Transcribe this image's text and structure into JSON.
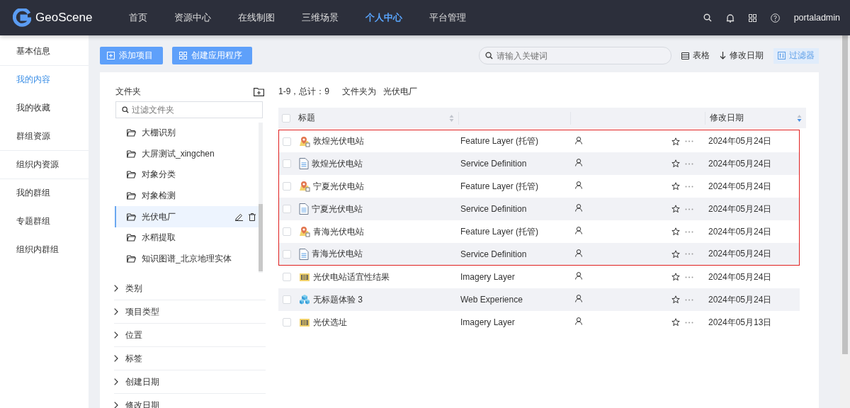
{
  "header": {
    "logo": "GeoScene",
    "nav": [
      {
        "label": "首页",
        "selected": false
      },
      {
        "label": "资源中心",
        "selected": false
      },
      {
        "label": "在线制图",
        "selected": false
      },
      {
        "label": "三维场景",
        "selected": false
      },
      {
        "label": "个人中心",
        "selected": true
      },
      {
        "label": "平台管理",
        "selected": false
      }
    ],
    "user": "portaladmin"
  },
  "sidebar": {
    "items": [
      {
        "label": "基本信息",
        "selected": false
      },
      {
        "label": "我的内容",
        "selected": true
      },
      {
        "label": "我的收藏",
        "selected": false
      },
      {
        "label": "群组资源",
        "selected": false
      },
      {
        "label": "组织内资源",
        "selected": false
      },
      {
        "label": "我的群组",
        "selected": false
      },
      {
        "label": "专题群组",
        "selected": false
      },
      {
        "label": "组织内群组",
        "selected": false
      }
    ]
  },
  "toolbar": {
    "buttons": [
      {
        "label": "添加项目",
        "kind": "add"
      },
      {
        "label": "创建应用程序",
        "kind": "apps"
      }
    ],
    "search": {
      "placeholder": "请输入关键词"
    },
    "view": "表格",
    "sort": "修改日期",
    "filter": {
      "label": "过滤器",
      "selected": true
    }
  },
  "folders": {
    "title": "文件夹",
    "search": {
      "placeholder": "过滤文件夹"
    },
    "items": [
      {
        "label": "大棚识别",
        "selected": false
      },
      {
        "label": "大屏测试_xingchen",
        "selected": false
      },
      {
        "label": "对象分类",
        "selected": false
      },
      {
        "label": "对象检测",
        "selected": false
      },
      {
        "label": "光伏电厂",
        "selected": true
      },
      {
        "label": "水稻提取",
        "selected": false
      },
      {
        "label": "知识图谱_北京地理实体",
        "selected": false
      }
    ]
  },
  "filters": [
    {
      "label": "类别",
      "expanded": false
    },
    {
      "label": "项目类型",
      "expanded": false
    },
    {
      "label": "位置",
      "expanded": false
    },
    {
      "label": "标签",
      "expanded": false
    },
    {
      "label": "创建日期",
      "expanded": false
    },
    {
      "label": "修改日期",
      "expanded": false
    }
  ],
  "results": {
    "summary": "1-9，总计：9",
    "folder_label": "文件夹为",
    "folder": "光伏电厂"
  },
  "table": {
    "all_checked": false,
    "columns": [
      {
        "label": "标题",
        "sorted": false
      },
      {
        "label": "修改日期",
        "sorted": true
      }
    ],
    "rows": [
      {
        "title": "敦煌光伏电站",
        "kind": "feature",
        "type": "Feature Layer (托管)",
        "date": "2024年05月24日",
        "highlighted": true
      },
      {
        "title": "敦煌光伏电站",
        "kind": "document",
        "type": "Service Definition",
        "date": "2024年05月24日",
        "highlighted": true
      },
      {
        "title": "宁夏光伏电站",
        "kind": "feature",
        "type": "Feature Layer (托管)",
        "date": "2024年05月24日",
        "highlighted": true
      },
      {
        "title": "宁夏光伏电站",
        "kind": "document",
        "type": "Service Definition",
        "date": "2024年05月24日",
        "highlighted": true
      },
      {
        "title": "青海光伏电站",
        "kind": "feature",
        "type": "Feature Layer (托管)",
        "date": "2024年05月24日",
        "highlighted": true
      },
      {
        "title": "青海光伏电站",
        "kind": "document",
        "type": "Service Definition",
        "date": "2024年05月24日",
        "highlighted": true
      },
      {
        "title": "光伏电站适宜性结果",
        "kind": "imagery",
        "type": "Imagery Layer",
        "date": "2024年05月24日",
        "highlighted": false
      },
      {
        "title": "无标题体验 3",
        "kind": "experience",
        "type": "Web Experience",
        "date": "2024年05月24日",
        "highlighted": false
      },
      {
        "title": "光伏选址",
        "kind": "imagery",
        "type": "Imagery Layer",
        "date": "2024年05月13日",
        "highlighted": false
      }
    ]
  }
}
